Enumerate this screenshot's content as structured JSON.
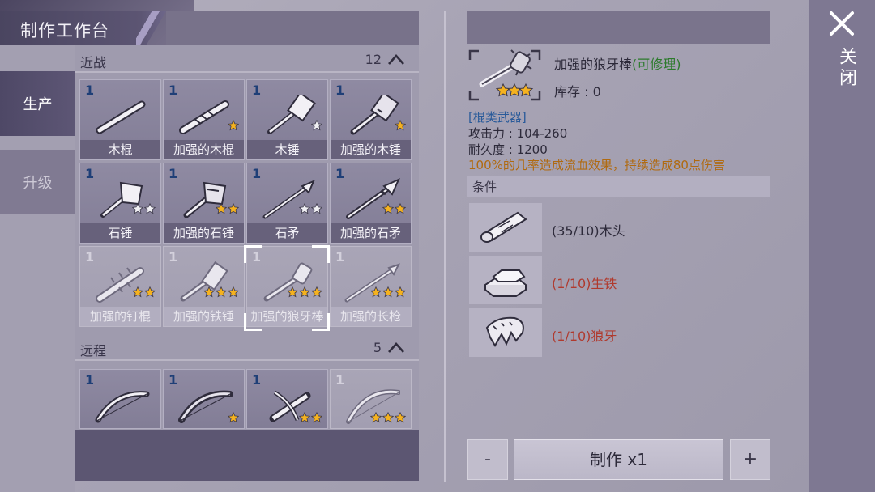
{
  "header": {
    "title": "制作工作台"
  },
  "side_tabs": [
    {
      "label": "生产",
      "active": true
    },
    {
      "label": "升级",
      "active": false
    }
  ],
  "melee": {
    "name": "近战",
    "count": "12",
    "items": [
      {
        "qty": "1",
        "label": "木棍",
        "stars": 0,
        "star_type": "none",
        "dim": false,
        "icon": "wooden-stick"
      },
      {
        "qty": "1",
        "label": "加强的木棍",
        "stars": 1,
        "star_type": "gold",
        "dim": false,
        "icon": "reinforced-stick"
      },
      {
        "qty": "1",
        "label": "木锤",
        "stars": 1,
        "star_type": "silver",
        "dim": false,
        "icon": "wooden-hammer"
      },
      {
        "qty": "1",
        "label": "加强的木锤",
        "stars": 1,
        "star_type": "gold",
        "dim": false,
        "icon": "reinforced-hammer"
      },
      {
        "qty": "1",
        "label": "石锤",
        "stars": 2,
        "star_type": "silver",
        "dim": false,
        "icon": "stone-hammer"
      },
      {
        "qty": "1",
        "label": "加强的石锤",
        "stars": 2,
        "star_type": "gold",
        "dim": false,
        "icon": "reinforced-stone-hammer"
      },
      {
        "qty": "1",
        "label": "石矛",
        "stars": 2,
        "star_type": "silver",
        "dim": false,
        "icon": "stone-spear"
      },
      {
        "qty": "1",
        "label": "加强的石矛",
        "stars": 2,
        "star_type": "gold",
        "dim": false,
        "icon": "reinforced-stone-spear"
      },
      {
        "qty": "1",
        "label": "加强的钉棍",
        "stars": 2,
        "star_type": "gold",
        "dim": true,
        "icon": "nail-club"
      },
      {
        "qty": "1",
        "label": "加强的铁锤",
        "stars": 3,
        "star_type": "gold",
        "dim": true,
        "icon": "iron-hammer"
      },
      {
        "qty": "1",
        "label": "加强的狼牙棒",
        "stars": 3,
        "star_type": "gold",
        "dim": true,
        "icon": "wolf-tooth-club"
      },
      {
        "qty": "1",
        "label": "加强的长枪",
        "stars": 3,
        "star_type": "gold",
        "dim": true,
        "icon": "long-spear"
      }
    ]
  },
  "ranged": {
    "name": "远程",
    "count": "5",
    "items": [
      {
        "qty": "1",
        "stars": 0,
        "star_type": "none",
        "dim": false,
        "icon": "bow"
      },
      {
        "qty": "1",
        "stars": 1,
        "star_type": "gold",
        "dim": false,
        "icon": "reinforced-bow"
      },
      {
        "qty": "1",
        "stars": 2,
        "star_type": "gold",
        "dim": false,
        "icon": "crossbow"
      },
      {
        "qty": "1",
        "stars": 3,
        "star_type": "gold",
        "dim": true,
        "icon": "longbow"
      }
    ]
  },
  "detail": {
    "name": "加强的狼牙棒",
    "repair_tag": "(可修理)",
    "stock": "库存 : 0",
    "stars": 3,
    "category": "[棍类武器]",
    "attack": "攻击力 : 104-260",
    "durability": "耐久度 : 1200",
    "effect": "100%的几率造成流血效果，持续造成80点伤害",
    "conditions_label": "条件",
    "requirements": [
      {
        "text": "(35/10)木头",
        "met": true,
        "icon": "wood-log-icon"
      },
      {
        "text": "(1/10)生铁",
        "met": false,
        "icon": "iron-ingot-icon"
      },
      {
        "text": "(1/10)狼牙",
        "met": false,
        "icon": "wolf-fang-icon"
      }
    ]
  },
  "actions": {
    "minus": "-",
    "craft": "制作 x1",
    "plus": "+"
  },
  "close": {
    "label": "关闭"
  },
  "colors": {
    "gold_star": "#f5b21f",
    "silver_star": "#f0f0f4",
    "qty_blue": "#1f3f77",
    "unmet_red": "#b03a2e",
    "repair_green": "#2c7a2c"
  }
}
